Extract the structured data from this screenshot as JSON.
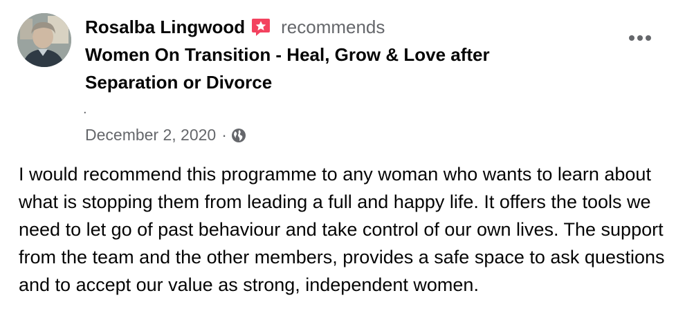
{
  "post": {
    "author_name": "Rosalba Lingwood",
    "action_verb": "recommends",
    "page_name": "Women On Transition - Heal, Grow & Love after Separation or Divorce",
    "separator_dot": ".",
    "date": "December 2, 2020",
    "meta_separator": "·",
    "review_text": "I would recommend this programme to any woman who wants to learn about what is stopping them from leading a full and happy life. It offers the tools we need to let go of past behaviour and take control of our own lives. The support from the team and the other members, provides a safe space to ask questions and to accept our value as strong, independent women."
  },
  "icons": {
    "recommend": "recommend-star-badge-icon",
    "audience": "globe-icon",
    "more": "more-options-icon"
  },
  "colors": {
    "primary_text": "#050505",
    "secondary_text": "#65676b",
    "recommend_badge": "#f3425f",
    "background": "#ffffff"
  }
}
